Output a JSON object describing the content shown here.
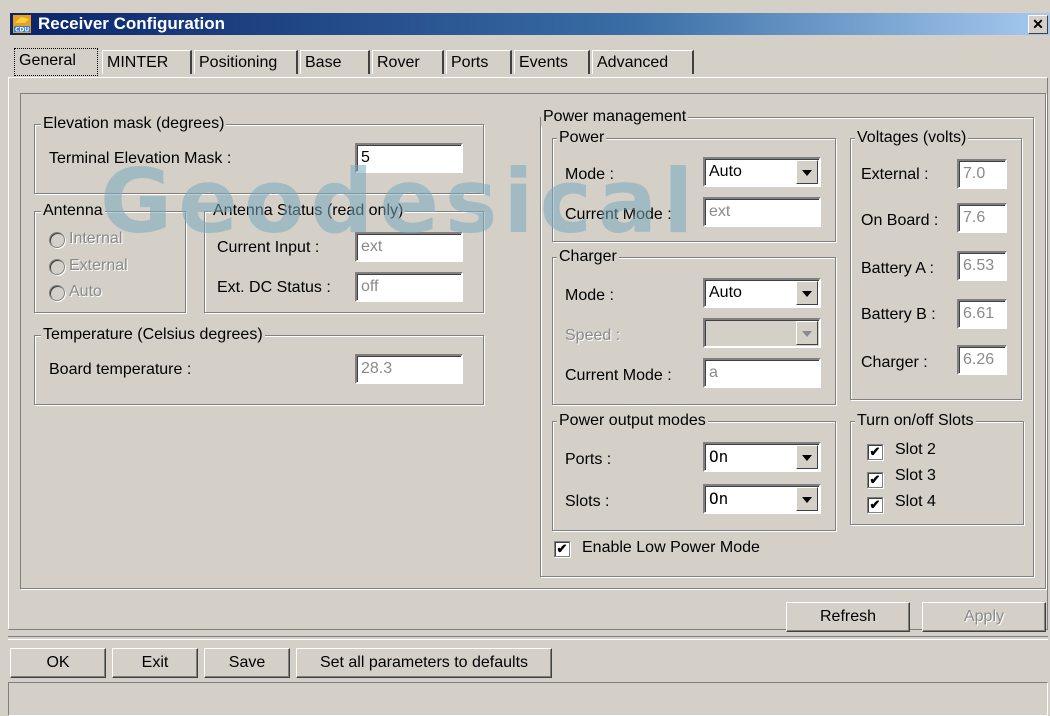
{
  "window": {
    "title": "Receiver Configuration",
    "icon": "cdu-app-icon",
    "close_label": "✕"
  },
  "tabs": [
    "General",
    "MINTER",
    "Positioning",
    "Base",
    "Rover",
    "Ports",
    "Events",
    "Advanced"
  ],
  "watermark": "Geodesical",
  "elevation": {
    "group": "Elevation mask (degrees)",
    "label": "Terminal Elevation Mask :",
    "value": "5"
  },
  "antenna": {
    "group": "Antenna",
    "options": [
      "Internal",
      "External",
      "Auto"
    ]
  },
  "antenna_status": {
    "group": "Antenna Status (read only)",
    "current_input_label": "Current Input :",
    "current_input": "ext",
    "dc_status_label": "Ext. DC Status :",
    "dc_status": "off"
  },
  "temperature": {
    "group": "Temperature (Celsius degrees)",
    "label": "Board temperature :",
    "value": "28.3"
  },
  "power_mgmt": {
    "group": "Power management",
    "power": {
      "group": "Power",
      "mode_label": "Mode :",
      "mode": "Auto",
      "current_label": "Current Mode :",
      "current": "ext"
    },
    "charger": {
      "group": "Charger",
      "mode_label": "Mode :",
      "mode": "Auto",
      "speed_label": "Speed :",
      "speed": "",
      "current_label": "Current Mode :",
      "current": "a"
    },
    "voltages": {
      "group": "Voltages (volts)",
      "items": [
        {
          "label": "External :",
          "value": "7.0"
        },
        {
          "label": "On Board :",
          "value": "7.6"
        },
        {
          "label": "Battery A :",
          "value": "6.53"
        },
        {
          "label": "Battery B :",
          "value": "6.61"
        },
        {
          "label": "Charger :",
          "value": "6.26"
        }
      ]
    },
    "output": {
      "group": "Power output modes",
      "ports_label": "Ports :",
      "ports": "On",
      "slots_label": "Slots :",
      "slots": "On"
    },
    "slots": {
      "group": "Turn on/off Slots",
      "items": [
        {
          "label": "Slot 2",
          "checked": true
        },
        {
          "label": "Slot 3",
          "checked": true
        },
        {
          "label": "Slot 4",
          "checked": true
        }
      ]
    },
    "low_power": {
      "label": "Enable Low Power Mode",
      "checked": true
    }
  },
  "buttons": {
    "refresh": "Refresh",
    "apply": "Apply",
    "ok": "OK",
    "exit": "Exit",
    "save": "Save",
    "defaults": "Set all parameters to defaults"
  },
  "check_mark": "✔"
}
